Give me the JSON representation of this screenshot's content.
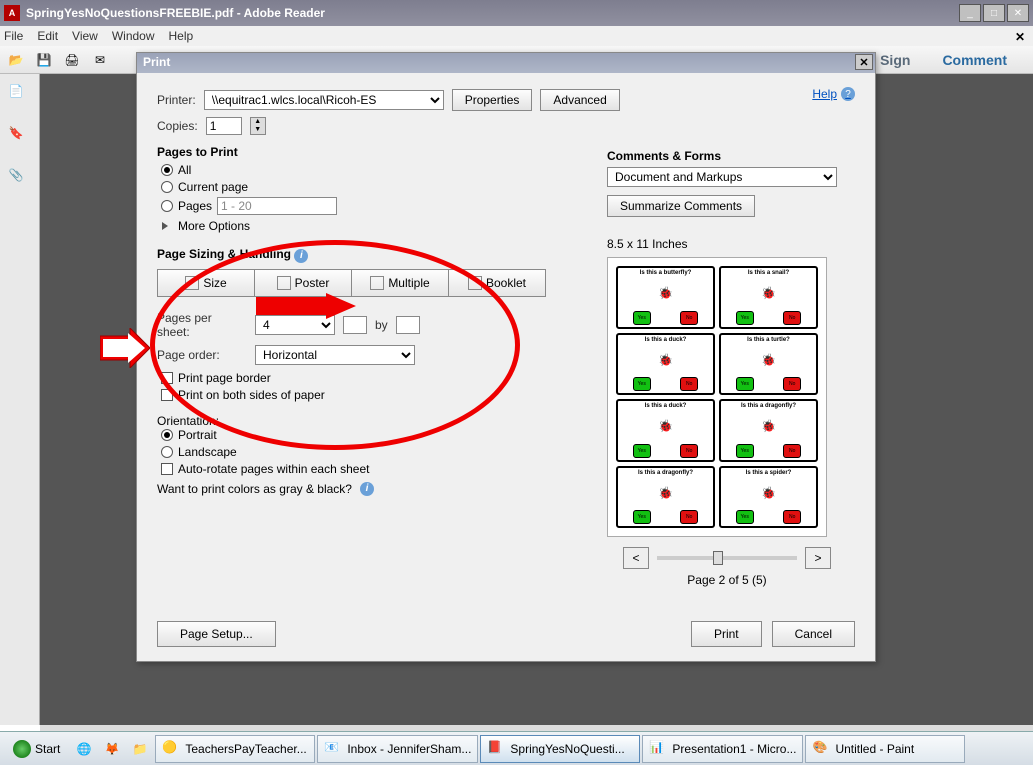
{
  "app": {
    "title": "SpringYesNoQuestionsFREEBIE.pdf - Adobe Reader",
    "icon_label": "A"
  },
  "menu": {
    "file": "File",
    "edit": "Edit",
    "view": "View",
    "window": "Window",
    "help": "Help"
  },
  "header_actions": {
    "sign": "Sign",
    "comment": "Comment"
  },
  "dialog": {
    "title": "Print",
    "printer_label": "Printer:",
    "printer_value": "\\\\equitrac1.wlcs.local\\Ricoh-ES",
    "properties": "Properties",
    "advanced": "Advanced",
    "help": "Help",
    "copies_label": "Copies:",
    "copies_value": "1",
    "pages_to_print": "Pages to Print",
    "all": "All",
    "current_page": "Current page",
    "pages": "Pages",
    "pages_range": "1 - 20",
    "more_options": "More Options",
    "sizing_handling": "Page Sizing & Handling",
    "size": "Size",
    "poster": "Poster",
    "multiple": "Multiple",
    "booklet": "Booklet",
    "pages_per_sheet": "Pages per sheet:",
    "pps_value": "4",
    "by": "by",
    "page_order": "Page order:",
    "page_order_value": "Horizontal",
    "print_border": "Print page border",
    "print_both_sides": "Print on both sides of paper",
    "orientation": "Orientation:",
    "portrait": "Portrait",
    "landscape": "Landscape",
    "auto_rotate": "Auto-rotate pages within each sheet",
    "gray_black": "Want to print colors as gray & black?",
    "comments_forms": "Comments & Forms",
    "doc_markups": "Document and Markups",
    "summarize": "Summarize Comments",
    "paper_dims": "8.5 x 11 Inches",
    "page_of": "Page 2 of 5 (5)",
    "page_setup": "Page Setup...",
    "print": "Print",
    "cancel": "Cancel",
    "preview_cards": [
      "Is this a butterfly?",
      "Is this a snail?",
      "Is this a duck?",
      "Is this a turtle?",
      "Is this a duck?",
      "Is this a dragonfly?",
      "Is this a dragonfly?",
      "Is this a spider?"
    ],
    "yes": "Yes",
    "no": "No"
  },
  "taskbar": {
    "start": "Start",
    "items": [
      {
        "label": "TeachersPayTeacher..."
      },
      {
        "label": "Inbox - JenniferSham..."
      },
      {
        "label": "SpringYesNoQuesti..."
      },
      {
        "label": "Presentation1 - Micro..."
      },
      {
        "label": "Untitled - Paint"
      }
    ]
  }
}
